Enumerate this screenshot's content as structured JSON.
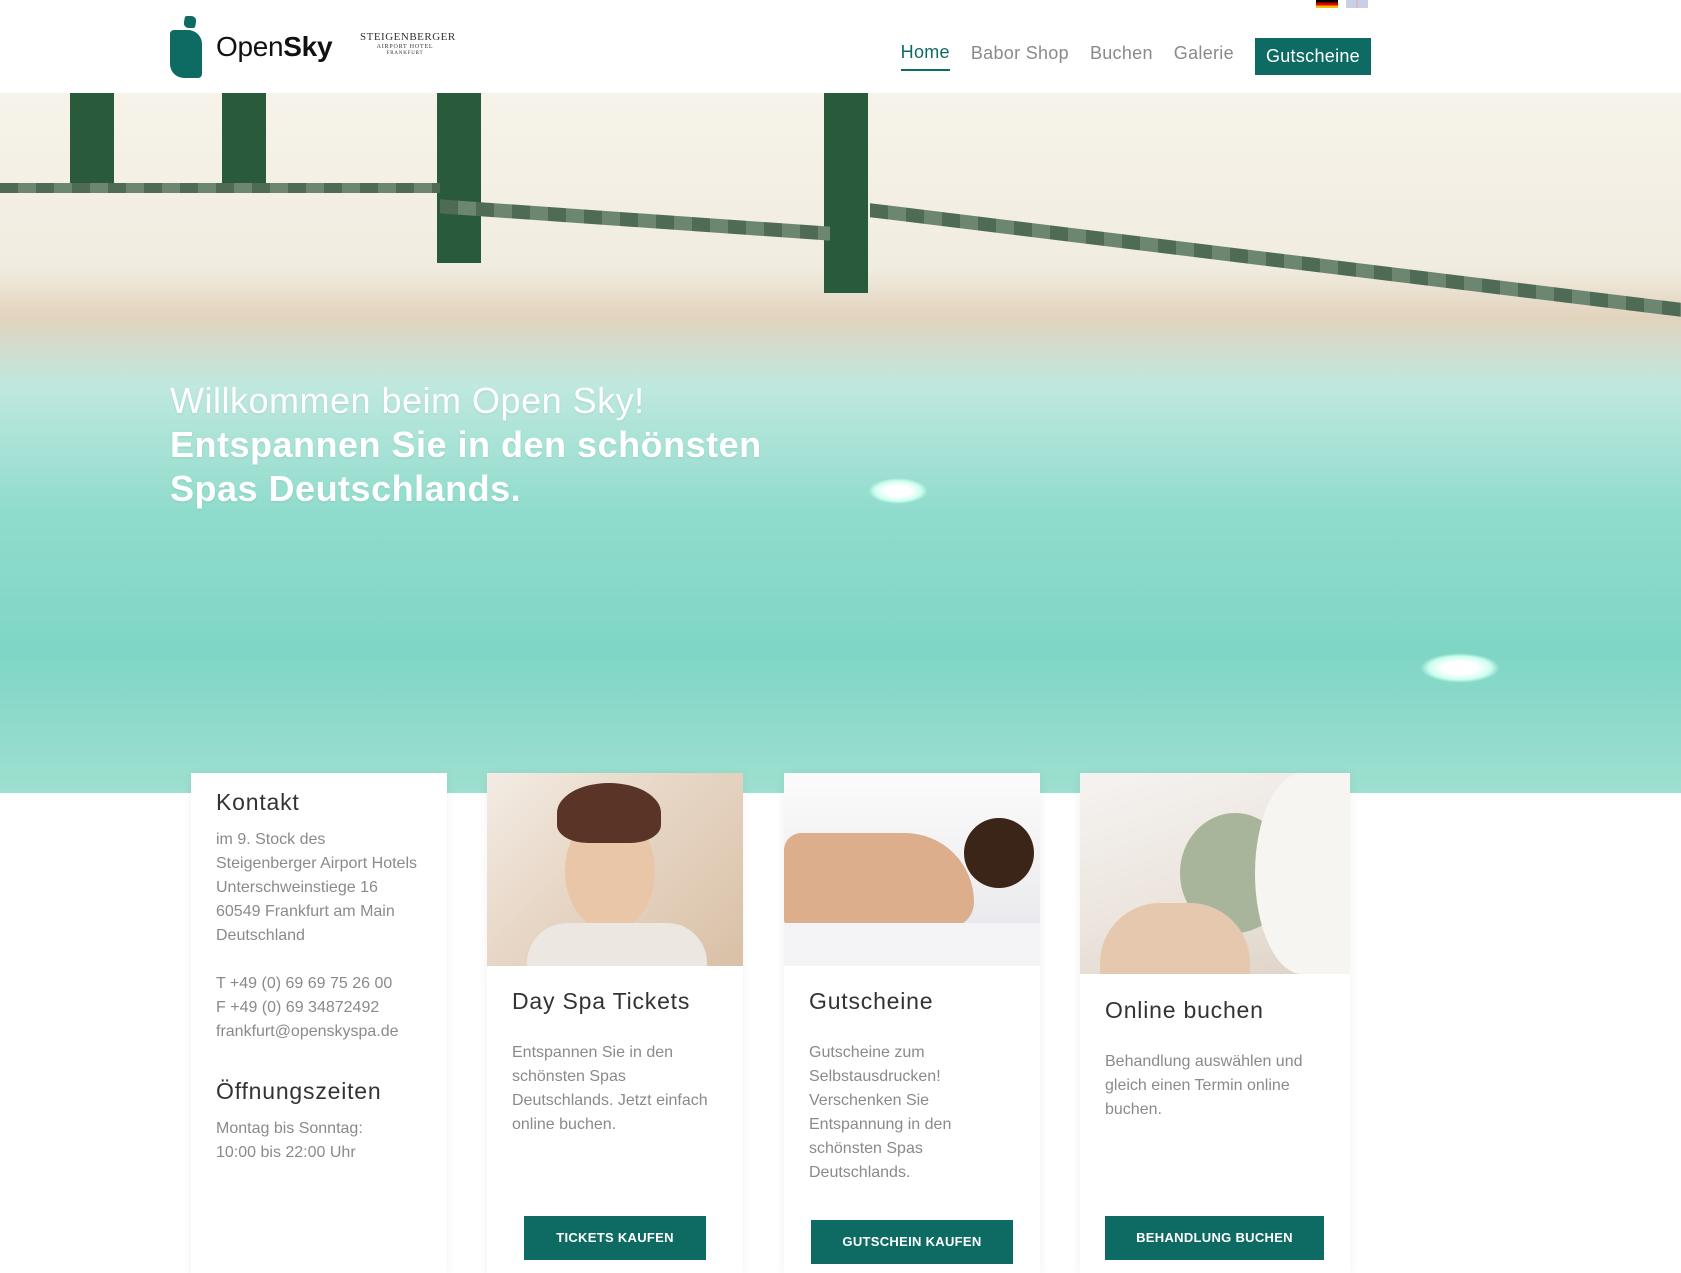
{
  "header": {
    "logo_open": "Open",
    "logo_sky": "Sky",
    "partner_line1": "STEIGENBERGER",
    "partner_line2": "AIRPORT HOTEL",
    "partner_line3": "FRANKFURT",
    "nav": {
      "home": "Home",
      "babor_shop": "Babor Shop",
      "buchen": "Buchen",
      "galerie": "Galerie",
      "gutscheine": "Gutscheine"
    }
  },
  "hero": {
    "line1": "Willkommen beim Open Sky!",
    "line2": "Entspannen Sie in den schönsten Spas Deutschlands."
  },
  "kontakt": {
    "title": "Kontakt",
    "address": [
      "im 9. Stock des",
      "Steigenberger Airport Hotels",
      "Unterschweinstiege 16",
      "60549 Frankfurt am Main",
      "Deutschland"
    ],
    "phone": "T +49 (0) 69 69 75 26 00",
    "fax": "F +49 (0) 69 34872492",
    "email": "frankfurt@openskyspa.de",
    "hours_title": "Öffnungszeiten",
    "hours_line1": "Montag bis Sonntag:",
    "hours_line2": "10:00 bis 22:00 Uhr"
  },
  "cards": [
    {
      "title": "Day Spa Tickets",
      "text": "Entspannen Sie in den schönsten Spas Deutschlands. Jetzt einfach online buchen.",
      "button": "TICKETS KAUFEN"
    },
    {
      "title": "Gutscheine",
      "text": "Gutscheine zum Selbstausdrucken! Verschenken Sie Entspannung in den schönsten Spas Deutschlands.",
      "button": "GUTSCHEIN KAUFEN"
    },
    {
      "title": "Online buchen",
      "text": "Behandlung auswählen und gleich einen Termin online buchen.",
      "button": "BEHANDLUNG BUCHEN"
    }
  ],
  "colors": {
    "brand": "#0e6b63",
    "nav_inactive": "#8a8a8a"
  }
}
